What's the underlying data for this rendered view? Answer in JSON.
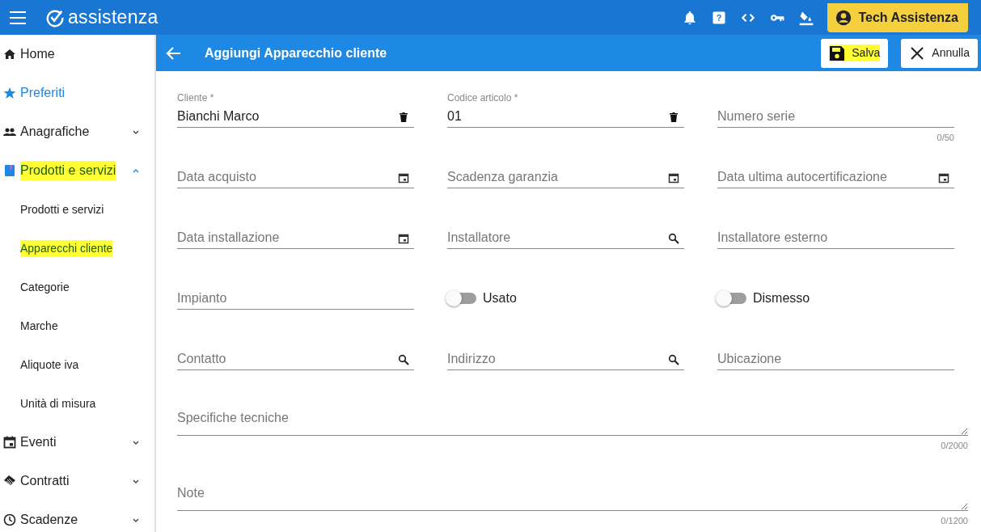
{
  "app_bar": {
    "logo_text": "assistenza",
    "help_icon": "?",
    "user_button": "Tech Assistenza"
  },
  "sidebar": {
    "items": [
      {
        "label": "Home",
        "kind": "item",
        "selected": false,
        "highlighted": false
      },
      {
        "label": "Preferiti",
        "kind": "favorite",
        "selected": false,
        "highlighted": false
      },
      {
        "label": "Anagrafiche",
        "kind": "group",
        "expanded": false,
        "selected": false,
        "highlighted": false
      },
      {
        "label": "Prodotti e servizi",
        "kind": "group",
        "expanded": true,
        "selected": true,
        "highlighted": true
      },
      {
        "label": "Prodotti e servizi",
        "kind": "sub",
        "selected": false,
        "highlighted": false
      },
      {
        "label": "Apparecchi cliente",
        "kind": "sub",
        "selected": true,
        "highlighted": true
      },
      {
        "label": "Categorie",
        "kind": "sub",
        "selected": false,
        "highlighted": false
      },
      {
        "label": "Marche",
        "kind": "sub",
        "selected": false,
        "highlighted": false
      },
      {
        "label": "Aliquote iva",
        "kind": "sub",
        "selected": false,
        "highlighted": false
      },
      {
        "label": "Unità di misura",
        "kind": "sub",
        "selected": false,
        "highlighted": false
      },
      {
        "label": "Eventi",
        "kind": "group",
        "expanded": false,
        "selected": false,
        "highlighted": false
      },
      {
        "label": "Contratti",
        "kind": "group",
        "expanded": false,
        "selected": false,
        "highlighted": false
      },
      {
        "label": "Scadenze",
        "kind": "group",
        "expanded": false,
        "selected": false,
        "highlighted": false
      }
    ]
  },
  "header": {
    "title": "Aggiungi Apparecchio cliente",
    "buttons": [
      {
        "label": "Salva",
        "kind": "save",
        "highlighted": true
      },
      {
        "label": "Annulla",
        "kind": "cancel",
        "highlighted": false
      }
    ]
  },
  "form": {
    "fields": [
      {
        "kind": "text",
        "label": "Cliente *",
        "value": "Bianchi Marco",
        "clearable": true
      },
      {
        "kind": "text",
        "label": "Codice articolo *",
        "value": "01",
        "clearable": true
      },
      {
        "kind": "text",
        "placeholder": "Numero serie",
        "counter": "0/50"
      },
      {
        "kind": "date",
        "placeholder": "Data acquisto"
      },
      {
        "kind": "date",
        "placeholder": "Scadenza garanzia"
      },
      {
        "kind": "date",
        "placeholder": "Data ultima autocertificazione"
      },
      {
        "kind": "date",
        "placeholder": "Data installazione"
      },
      {
        "kind": "lookup",
        "placeholder": "Installatore"
      },
      {
        "kind": "text",
        "placeholder": "Installatore esterno"
      },
      {
        "kind": "text",
        "placeholder": "Impianto"
      },
      {
        "kind": "toggle",
        "label": "Usato",
        "on": false
      },
      {
        "kind": "toggle",
        "label": "Dismesso",
        "on": false
      },
      {
        "kind": "lookup",
        "placeholder": "Contatto"
      },
      {
        "kind": "lookup",
        "placeholder": "Indirizzo"
      },
      {
        "kind": "text",
        "placeholder": "Ubicazione"
      },
      {
        "kind": "textarea",
        "placeholder": "Specifiche tecniche",
        "counter": "0/2000"
      },
      {
        "kind": "textarea",
        "placeholder": "Note",
        "counter": "0/1200"
      }
    ]
  }
}
